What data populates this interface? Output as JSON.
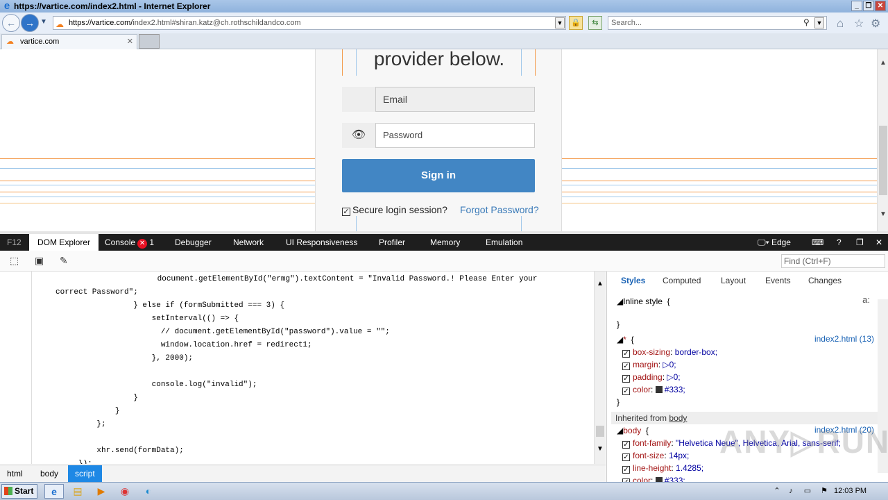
{
  "window": {
    "title": "https://vartice.com/index2.html - Internet Explorer",
    "min_label": "_",
    "max_label": "❐",
    "close_label": "✕"
  },
  "nav": {
    "back_label": "←",
    "forward_label": "→",
    "address_host": "https://vartice.com/",
    "address_rest": "index2.html#shiran.katz@ch.rothschildandco.com",
    "search_placeholder": "Search...",
    "lock_icon": "🔒"
  },
  "tabs": [
    {
      "label": "vartice.com",
      "close": "✕"
    }
  ],
  "page": {
    "heading": "provider below.",
    "email_placeholder": "Email",
    "password_placeholder": "Password",
    "eye_icon": "👁",
    "signin_label": "Sign in",
    "remember_label": "Secure login session?",
    "forgot_label": "Forgot Password?",
    "line_colors": [
      "#f39b4c",
      "#9fc7ea",
      "#f39b4c",
      "#9fc7ea",
      "#f39b4c",
      "#9fc7ea",
      "#f5c483"
    ]
  },
  "devtools": {
    "tabs": [
      "F12",
      "DOM Explorer",
      "Console",
      "Debugger",
      "Network",
      "UI Responsiveness",
      "Profiler",
      "Memory",
      "Emulation"
    ],
    "console_errors": "1",
    "mode_label": "Edge",
    "find_placeholder": "Find (Ctrl+F)",
    "code_lines": [
      "                     document.getElementById(\"ermg\").textContent = \"Invalid Password.! Please Enter your",
      "correct Password\";",
      "                 } else if (formSubmitted === 3) {",
      "                     setInterval(() => {",
      "                       // document.getElementById(\"password\").value = \"\";",
      "                       window.location.href = redirect1;",
      "                     }, 2000);",
      "",
      "                     console.log(\"invalid\");",
      "                 }",
      "             }",
      "         };",
      "",
      "         xhr.send(formData);",
      "     });"
    ],
    "breadcrumb": [
      "html",
      "body",
      "script"
    ],
    "styles_tabs": [
      "Styles",
      "Computed",
      "Layout",
      "Events",
      "Changes"
    ],
    "inline_style": "Inline style",
    "rule1_selector": "*",
    "rule1_source": "index2.html (13)",
    "rule1_props": [
      {
        "name": "box-sizing",
        "value": "border-box;"
      },
      {
        "name": "margin",
        "value": "▷0;"
      },
      {
        "name": "padding",
        "value": "▷0;"
      },
      {
        "name": "color",
        "value": "#333;"
      }
    ],
    "inherited_label": "Inherited from",
    "inherited_from": "body",
    "rule2_selector": "body",
    "rule2_source": "index2.html (20)",
    "rule2_props": [
      {
        "name": "font-family",
        "value": "\"Helvetica Neue\", Helvetica, Arial, sans-serif;"
      },
      {
        "name": "font-size",
        "value": "14px;"
      },
      {
        "name": "line-height",
        "value": "1.4285;"
      },
      {
        "name": "color",
        "value": "#333;"
      }
    ]
  },
  "taskbar": {
    "start_label": "Start",
    "clock": "12:03 PM"
  }
}
